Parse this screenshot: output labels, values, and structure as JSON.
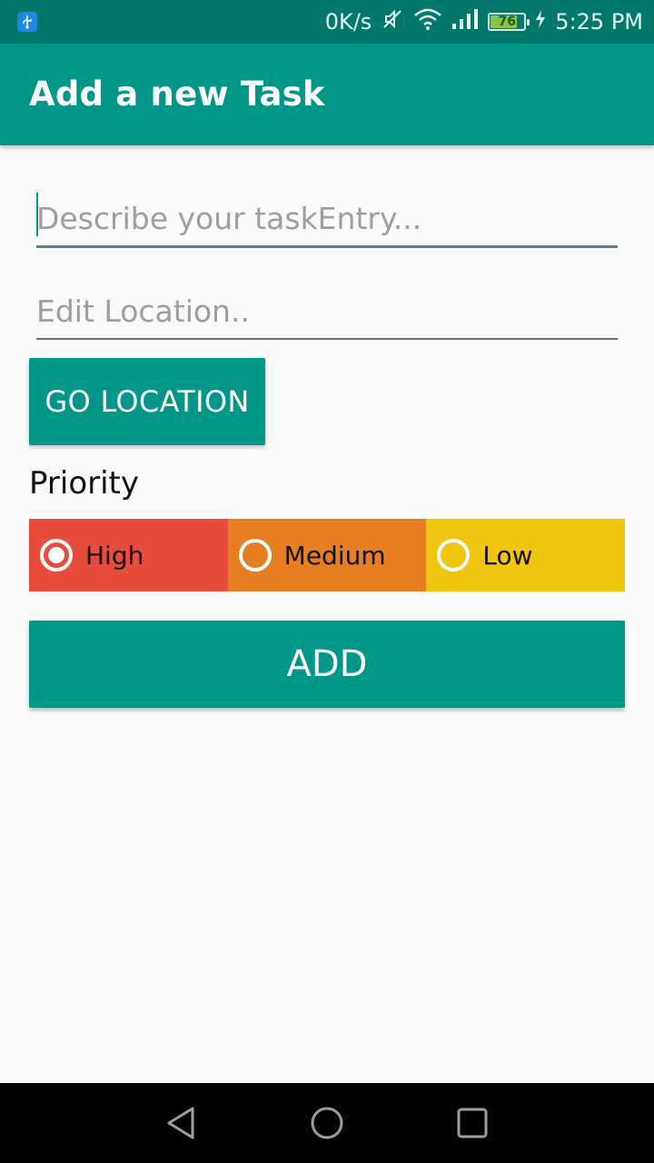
{
  "status_bar": {
    "network_speed": "0K/s",
    "battery_level": "76",
    "time": "5:25 PM",
    "icons": [
      "usb-icon",
      "mute-icon",
      "wifi-icon",
      "signal-icon",
      "battery-icon",
      "charging-icon"
    ]
  },
  "app_bar": {
    "title": "Add a new Task"
  },
  "form": {
    "task_placeholder": "Describe your taskEntry...",
    "location_placeholder": "Edit Location..",
    "go_location_label": "GO LOCATION",
    "priority_label": "Priority",
    "priorities": [
      {
        "label": "High",
        "color": "#e74c3c",
        "selected": true
      },
      {
        "label": "Medium",
        "color": "#e67e22",
        "selected": false
      },
      {
        "label": "Low",
        "color": "#f1c40f",
        "selected": false
      }
    ],
    "add_label": "ADD"
  },
  "nav_bar": {
    "icons": [
      "back-icon",
      "home-icon",
      "recents-icon"
    ]
  },
  "colors": {
    "primary": "#009688",
    "primary_dark": "#00796b",
    "background": "#fafafa"
  }
}
